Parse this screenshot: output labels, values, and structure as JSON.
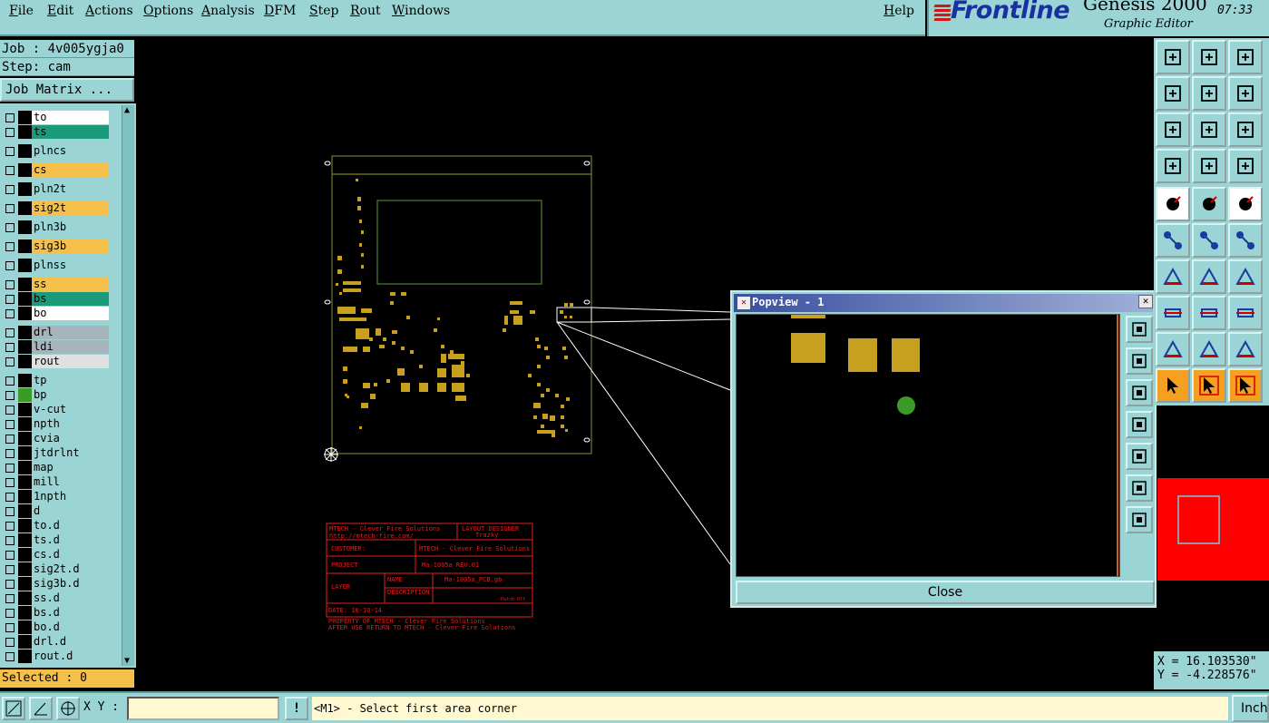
{
  "menu": {
    "items": [
      "File",
      "Edit",
      "Actions",
      "Options",
      "Analysis",
      "DFM",
      "Step",
      "Rout",
      "Windows"
    ],
    "help": "Help"
  },
  "brand": {
    "logo": "Frontline",
    "product": "Genesis 2000",
    "subtitle": "Graphic Editor",
    "time": "07:33"
  },
  "job": {
    "job_label": "Job : 4v005ygja0",
    "step_label": "Step: cam",
    "matrix_button": "Job Matrix ..."
  },
  "layers": [
    {
      "name": "to",
      "color": "#ffffff",
      "swatch": "#000000"
    },
    {
      "name": "ts",
      "color": "#1a9a7a",
      "swatch": "#000000"
    },
    {
      "name": "plncs",
      "color": "#9ad4d4",
      "swatch": "#000000"
    },
    {
      "name": "cs",
      "color": "#f5c04a",
      "swatch": "#000000"
    },
    {
      "name": "pln2t",
      "color": "#9ad4d4",
      "swatch": "#000000"
    },
    {
      "name": "sig2t",
      "color": "#f5c04a",
      "swatch": "#000000"
    },
    {
      "name": "pln3b",
      "color": "#9ad4d4",
      "swatch": "#000000"
    },
    {
      "name": "sig3b",
      "color": "#f5c04a",
      "swatch": "#000000"
    },
    {
      "name": "plnss",
      "color": "#9ad4d4",
      "swatch": "#000000"
    },
    {
      "name": "ss",
      "color": "#f5c04a",
      "swatch": "#000000"
    },
    {
      "name": "bs",
      "color": "#1a9a7a",
      "swatch": "#000000"
    },
    {
      "name": "bo",
      "color": "#ffffff",
      "swatch": "#000000"
    },
    {
      "name": "drl",
      "color": "#a8b4bc",
      "swatch": "#000000"
    },
    {
      "name": "ldi",
      "color": "#a8b4bc",
      "swatch": "#000000"
    },
    {
      "name": "rout",
      "color": "#e0e0e0",
      "swatch": "#000000"
    },
    {
      "name": "tp",
      "color": "#9ad4d4",
      "swatch": "#000000"
    },
    {
      "name": "bp",
      "color": "#9ad4d4",
      "swatch": "#3c9a28"
    },
    {
      "name": "v-cut",
      "color": "#9ad4d4",
      "swatch": "#000000"
    },
    {
      "name": "npth",
      "color": "#9ad4d4",
      "swatch": "#000000"
    },
    {
      "name": "cvia",
      "color": "#9ad4d4",
      "swatch": "#000000"
    },
    {
      "name": "jtdrlnt",
      "color": "#9ad4d4",
      "swatch": "#000000"
    },
    {
      "name": "map",
      "color": "#9ad4d4",
      "swatch": "#000000"
    },
    {
      "name": "mill",
      "color": "#9ad4d4",
      "swatch": "#000000"
    },
    {
      "name": "1npth",
      "color": "#9ad4d4",
      "swatch": "#000000"
    },
    {
      "name": "d",
      "color": "#9ad4d4",
      "swatch": "#000000"
    },
    {
      "name": "to.d",
      "color": "#9ad4d4",
      "swatch": "#000000"
    },
    {
      "name": "ts.d",
      "color": "#9ad4d4",
      "swatch": "#000000"
    },
    {
      "name": "cs.d",
      "color": "#9ad4d4",
      "swatch": "#000000"
    },
    {
      "name": "sig2t.d",
      "color": "#9ad4d4",
      "swatch": "#000000"
    },
    {
      "name": "sig3b.d",
      "color": "#9ad4d4",
      "swatch": "#000000"
    },
    {
      "name": "ss.d",
      "color": "#9ad4d4",
      "swatch": "#000000"
    },
    {
      "name": "bs.d",
      "color": "#9ad4d4",
      "swatch": "#000000"
    },
    {
      "name": "bo.d",
      "color": "#9ad4d4",
      "swatch": "#000000"
    },
    {
      "name": "drl.d",
      "color": "#9ad4d4",
      "swatch": "#000000"
    },
    {
      "name": "rout.d",
      "color": "#9ad4d4",
      "swatch": "#000000"
    }
  ],
  "selected_label": "Selected : 0",
  "title_block": {
    "company": "MTECH - Clever Fire Solutions",
    "url": "http://mtech-fire.com/",
    "designer_label": "LAYOUT DESIGNER",
    "designer": "Trazky",
    "customer_label": "CUSTOMER:",
    "customer": "MTECH - Clever Fire Solutions",
    "project_label": "PROJECT",
    "project": "Ma-1005a REV.01",
    "layer_label": "LAYER",
    "name_label": "NAME",
    "name_value": "Ma-1005a_PCB.gb",
    "description_label": "DESCRIPTION",
    "desc_note": "Patch Off",
    "date_label": "DATE: 10-10-14",
    "footer1": "PROPERTY OF MTECH - Clever Fire Solutions",
    "footer2": "AFTER USE RETURN TO MTECH - Clever Fire Solutions"
  },
  "popview": {
    "title": "Popview - 1",
    "close_button": "Close"
  },
  "coords": {
    "x": "X = 16.103530\"",
    "y": "Y = -4.228576\""
  },
  "bottom": {
    "xy_label": "X Y :",
    "xy_value": "",
    "warn": "!",
    "prompt": "<M1> - Select first area corner",
    "units_button": "Inch"
  },
  "colors": {
    "panel": "#9ad4d4",
    "copper": "#c8a020",
    "outline": "#7a9a3a",
    "board_frame": "#a0a020",
    "title_block": "#e02020",
    "overview_bg": "#ff0000"
  }
}
